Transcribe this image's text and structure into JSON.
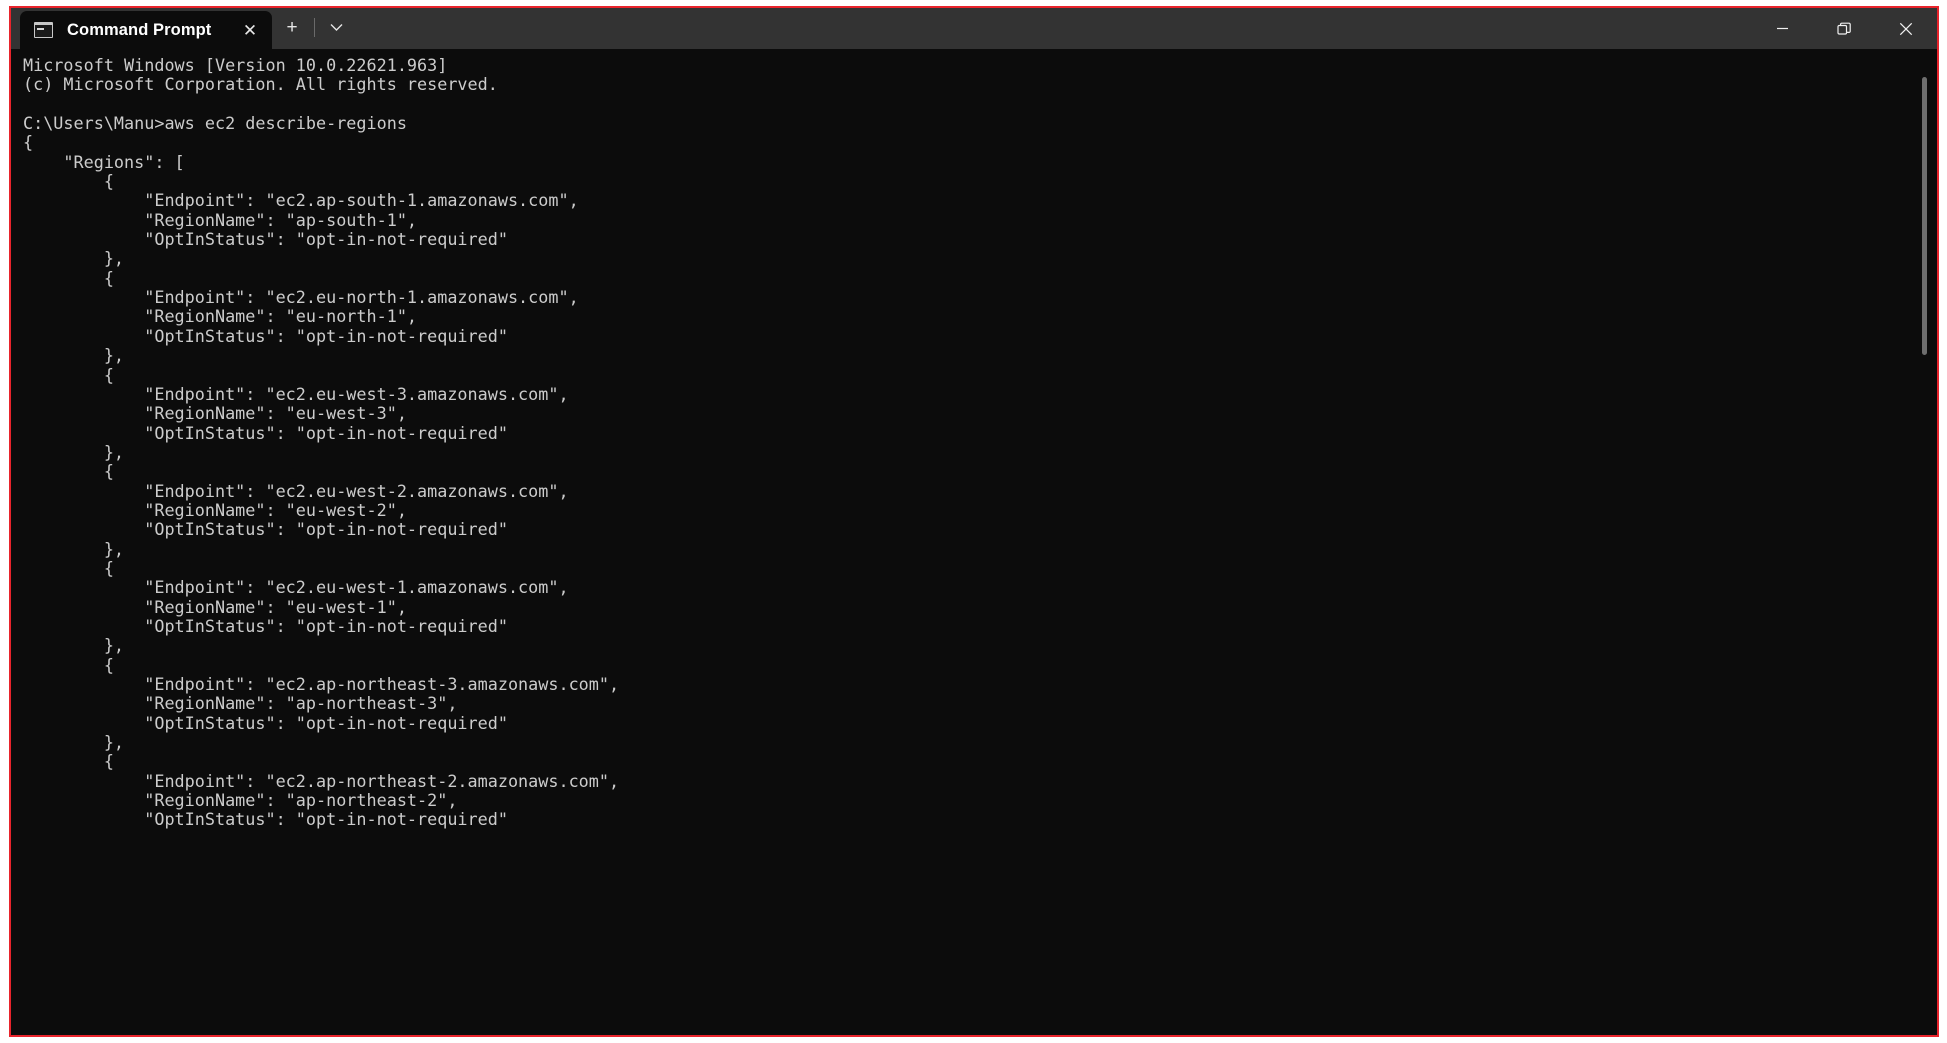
{
  "window": {
    "app_name": "Command Prompt",
    "accent_border_color": "#e8242c",
    "titlebar_color": "#333333",
    "terminal_bg_color": "#0c0c0c",
    "terminal_fg_color": "#cccccc"
  },
  "tab": {
    "title": "Command Prompt",
    "icon": "console-icon",
    "close_label": "✕"
  },
  "tab_tools": {
    "new_tab_label": "+",
    "dropdown_label": "⌄"
  },
  "window_controls": {
    "minimize_label": "minimize-icon",
    "maximize_label": "restore-icon",
    "close_label": "close-icon"
  },
  "terminal": {
    "lines": [
      "Microsoft Windows [Version 10.0.22621.963]",
      "(c) Microsoft Corporation. All rights reserved.",
      "",
      "C:\\Users\\Manu>aws ec2 describe-regions",
      "{",
      "    \"Regions\": [",
      "        {",
      "            \"Endpoint\": \"ec2.ap-south-1.amazonaws.com\",",
      "            \"RegionName\": \"ap-south-1\",",
      "            \"OptInStatus\": \"opt-in-not-required\"",
      "        },",
      "        {",
      "            \"Endpoint\": \"ec2.eu-north-1.amazonaws.com\",",
      "            \"RegionName\": \"eu-north-1\",",
      "            \"OptInStatus\": \"opt-in-not-required\"",
      "        },",
      "        {",
      "            \"Endpoint\": \"ec2.eu-west-3.amazonaws.com\",",
      "            \"RegionName\": \"eu-west-3\",",
      "            \"OptInStatus\": \"opt-in-not-required\"",
      "        },",
      "        {",
      "            \"Endpoint\": \"ec2.eu-west-2.amazonaws.com\",",
      "            \"RegionName\": \"eu-west-2\",",
      "            \"OptInStatus\": \"opt-in-not-required\"",
      "        },",
      "        {",
      "            \"Endpoint\": \"ec2.eu-west-1.amazonaws.com\",",
      "            \"RegionName\": \"eu-west-1\",",
      "            \"OptInStatus\": \"opt-in-not-required\"",
      "        },",
      "        {",
      "            \"Endpoint\": \"ec2.ap-northeast-3.amazonaws.com\",",
      "            \"RegionName\": \"ap-northeast-3\",",
      "            \"OptInStatus\": \"opt-in-not-required\"",
      "        },",
      "        {",
      "            \"Endpoint\": \"ec2.ap-northeast-2.amazonaws.com\",",
      "            \"RegionName\": \"ap-northeast-2\",",
      "            \"OptInStatus\": \"opt-in-not-required\""
    ],
    "command": "aws ec2 describe-regions",
    "prompt": "C:\\Users\\Manu>",
    "os_banner": "Microsoft Windows [Version 10.0.22621.963]",
    "copyright": "(c) Microsoft Corporation. All rights reserved.",
    "regions": [
      {
        "Endpoint": "ec2.ap-south-1.amazonaws.com",
        "RegionName": "ap-south-1",
        "OptInStatus": "opt-in-not-required"
      },
      {
        "Endpoint": "ec2.eu-north-1.amazonaws.com",
        "RegionName": "eu-north-1",
        "OptInStatus": "opt-in-not-required"
      },
      {
        "Endpoint": "ec2.eu-west-3.amazonaws.com",
        "RegionName": "eu-west-3",
        "OptInStatus": "opt-in-not-required"
      },
      {
        "Endpoint": "ec2.eu-west-2.amazonaws.com",
        "RegionName": "eu-west-2",
        "OptInStatus": "opt-in-not-required"
      },
      {
        "Endpoint": "ec2.eu-west-1.amazonaws.com",
        "RegionName": "eu-west-1",
        "OptInStatus": "opt-in-not-required"
      },
      {
        "Endpoint": "ec2.ap-northeast-3.amazonaws.com",
        "RegionName": "ap-northeast-3",
        "OptInStatus": "opt-in-not-required"
      },
      {
        "Endpoint": "ec2.ap-northeast-2.amazonaws.com",
        "RegionName": "ap-northeast-2",
        "OptInStatus": "opt-in-not-required"
      }
    ]
  }
}
